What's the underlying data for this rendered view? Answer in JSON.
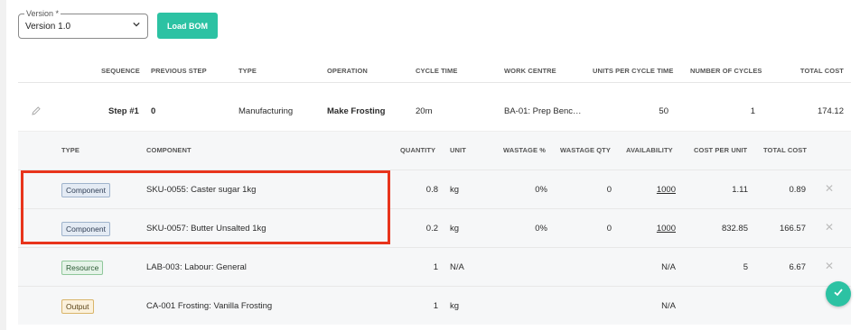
{
  "version": {
    "label": "Version *",
    "value": "Version 1.0"
  },
  "load_bom_label": "Load BOM",
  "routing_header": {
    "sequence": "SEQUENCE",
    "previous_step": "PREVIOUS STEP",
    "type": "TYPE",
    "operation": "OPERATION",
    "cycle_time": "CYCLE TIME",
    "work_centre": "WORK CENTRE",
    "units_per_cycle_time": "UNITS PER CYCLE TIME",
    "number_of_cycles": "NUMBER OF CYCLES",
    "total_cost": "TOTAL COST"
  },
  "step": {
    "sequence": "Step #1",
    "previous_step": "0",
    "type": "Manufacturing",
    "operation": "Make Frosting",
    "cycle_time": "20m",
    "work_centre": "BA-01: Prep Benc…",
    "units_per_cycle_time": "50",
    "number_of_cycles": "1",
    "total_cost": "174.12"
  },
  "component_header": {
    "type": "TYPE",
    "component": "COMPONENT",
    "quantity": "QUANTITY",
    "unit": "UNIT",
    "wastage_pct": "WASTAGE %",
    "wastage_qty": "WASTAGE QTY",
    "availability": "AVAILABILITY",
    "cost_per_unit": "COST PER UNIT",
    "total_cost": "TOTAL COST"
  },
  "components": [
    {
      "type": "Component",
      "kind": "component",
      "component": "SKU-0055: Caster sugar 1kg",
      "quantity": "0.8",
      "unit": "kg",
      "wastage_pct": "0%",
      "wastage_qty": "0",
      "availability": "1000",
      "cost_per_unit": "1.11",
      "total_cost": "0.89"
    },
    {
      "type": "Component",
      "kind": "component",
      "component": "SKU-0057: Butter Unsalted 1kg",
      "quantity": "0.2",
      "unit": "kg",
      "wastage_pct": "0%",
      "wastage_qty": "0",
      "availability": "1000",
      "cost_per_unit": "832.85",
      "total_cost": "166.57"
    },
    {
      "type": "Resource",
      "kind": "resource",
      "component": "LAB-003: Labour: General",
      "quantity": "1",
      "unit": "N/A",
      "wastage_pct": "",
      "wastage_qty": "",
      "availability": "N/A",
      "cost_per_unit": "5",
      "total_cost": "6.67"
    },
    {
      "type": "Output",
      "kind": "output",
      "component": "CA-001 Frosting: Vanilla Frosting",
      "quantity": "1",
      "unit": "kg",
      "wastage_pct": "",
      "wastage_qty": "",
      "availability": "N/A",
      "cost_per_unit": "",
      "total_cost": ""
    }
  ],
  "colors": {
    "accent": "#2cc2a3",
    "highlight": "#e8341c"
  },
  "icons": {
    "edit": "pencil-icon",
    "select": "chevron-down-icon",
    "remove": "close-icon",
    "confirm": "check-icon"
  }
}
